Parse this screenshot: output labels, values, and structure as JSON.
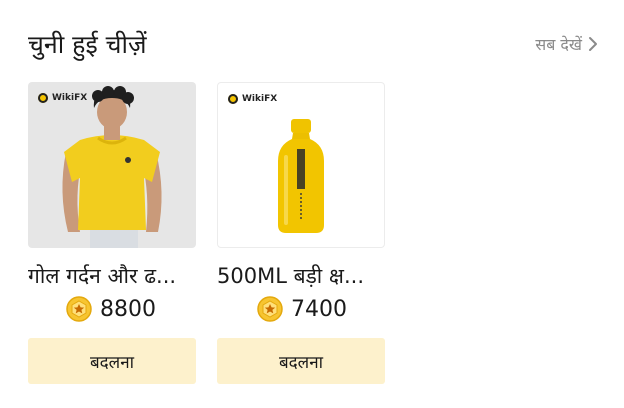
{
  "section": {
    "title": "चुनी हुई चीज़ें",
    "see_all_label": "सब देखें"
  },
  "products": [
    {
      "brand": "WikiFX",
      "name": "गोल गर्दन और ढ...",
      "price": "8800",
      "redeem_label": "बदलना",
      "image": "yellow-tshirt-model"
    },
    {
      "brand": "WikiFX",
      "name": "500ML बड़ी क्ष...",
      "price": "7400",
      "redeem_label": "बदलना",
      "image": "yellow-water-bottle"
    }
  ],
  "colors": {
    "accent_yellow": "#f5c400",
    "redeem_bg": "#fdf1cc",
    "muted_text": "#8a8a8a"
  }
}
